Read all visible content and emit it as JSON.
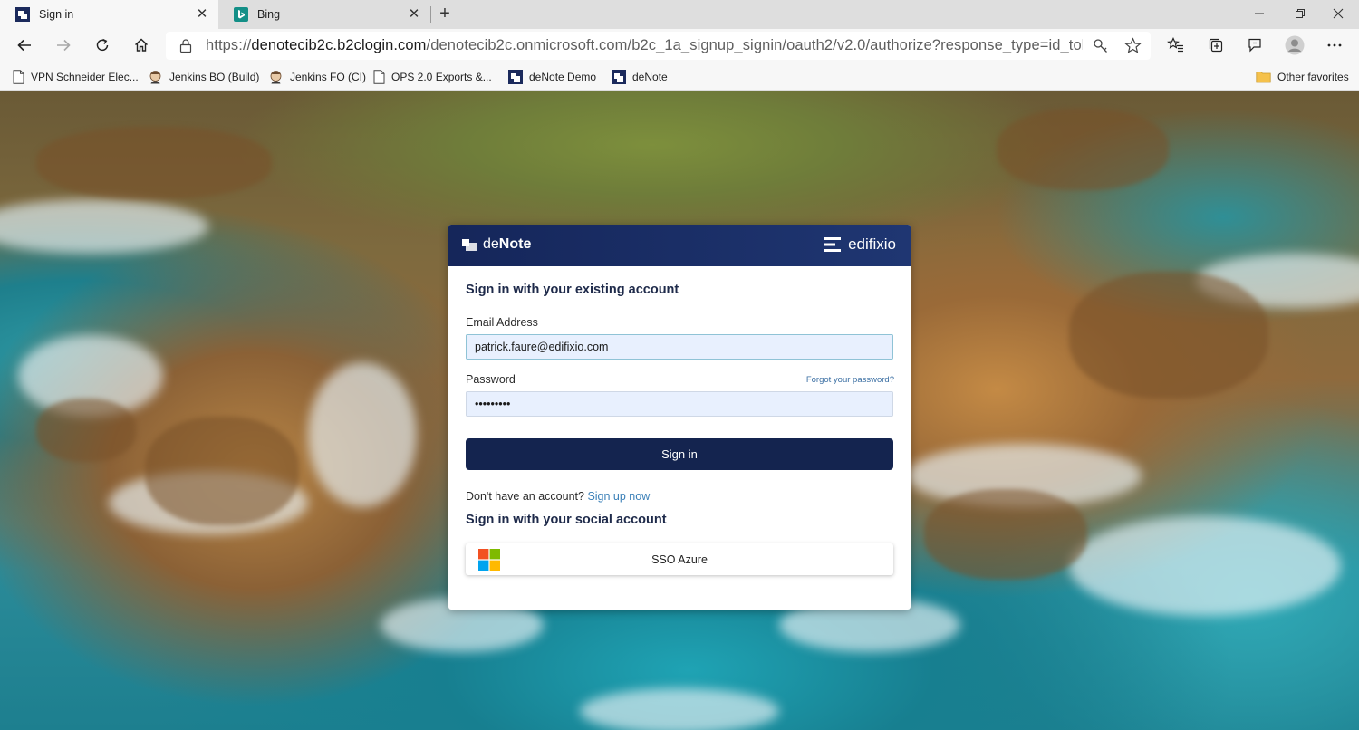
{
  "browser": {
    "tabs": [
      {
        "title": "Sign in",
        "active": true
      },
      {
        "title": "Bing",
        "active": false
      }
    ],
    "address": {
      "scheme": "https://",
      "host": "denotecib2c.b2clogin.com",
      "path": "/denotecib2c.onmicrosoft.com/b2c_1a_signup_signin/oauth2/v2.0/authorize?response_type=id_token&s..."
    },
    "favorites": [
      {
        "label": "VPN Schneider Elec...",
        "icon": "page-icon"
      },
      {
        "label": "Jenkins BO (Build)",
        "icon": "jenkins-icon"
      },
      {
        "label": "Jenkins FO (CI)",
        "icon": "jenkins-icon"
      },
      {
        "label": "OPS 2.0  Exports &...",
        "icon": "page-icon"
      },
      {
        "label": "deNote Demo",
        "icon": "denote-icon"
      },
      {
        "label": "deNote",
        "icon": "denote-icon"
      }
    ],
    "other_favorites": "Other favorites"
  },
  "card": {
    "brand_left_de": "de",
    "brand_left_note": "Note",
    "brand_right": "edifixio",
    "title": "Sign in with your existing account",
    "email_label": "Email Address",
    "email_value": "patrick.faure@edifixio.com",
    "password_label": "Password",
    "password_value": "•••••••••",
    "forgot": "Forgot your password?",
    "signin_button": "Sign in",
    "no_account_text": "Don't have an account?",
    "signup_link": "Sign up now",
    "social_title": "Sign in with your social account",
    "sso_button": "SSO Azure"
  },
  "colors": {
    "card_header": "#15265a",
    "signin_button": "#14244f",
    "link": "#3b80b8",
    "input_bg": "#e8f0fe"
  }
}
